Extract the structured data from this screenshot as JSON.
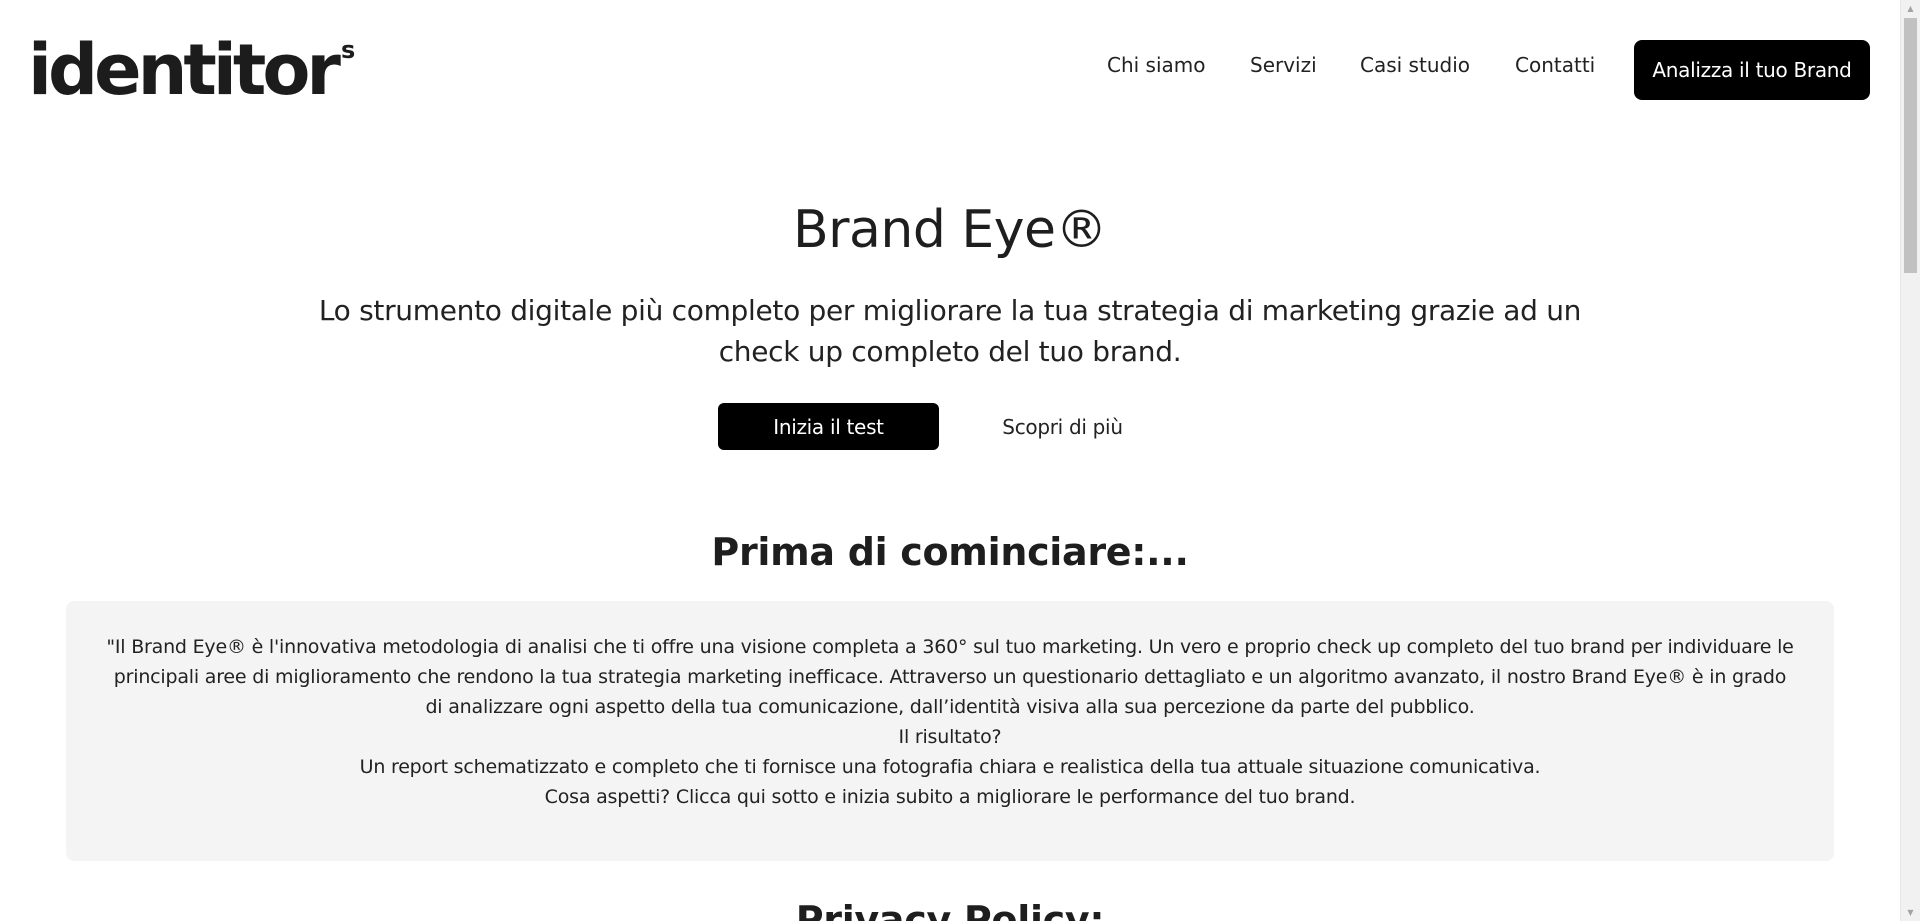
{
  "header": {
    "logo_text": "identitor",
    "logo_superscript": "s",
    "nav": [
      {
        "label": "Chi siamo"
      },
      {
        "label": "Servizi"
      },
      {
        "label": "Casi studio"
      },
      {
        "label": "Contatti"
      }
    ],
    "cta_label": "Analizza il tuo Brand"
  },
  "hero": {
    "title": "Brand Eye®",
    "subtitle": "Lo strumento digitale più completo per migliorare la tua strategia di marketing grazie ad un check up completo del tuo brand.",
    "primary_button": "Inizia il test",
    "secondary_button": "Scopri di più"
  },
  "intro": {
    "title": "Prima di cominciare:...",
    "paragraphs": [
      "\"Il Brand Eye® è l'innovativa metodologia di analisi che ti offre una visione completa a 360° sul tuo marketing. Un vero e proprio check up completo del tuo brand per individuare le principali aree di miglioramento che rendono la tua strategia marketing inefficace. Attraverso un questionario dettagliato e un algoritmo avanzato, il nostro Brand Eye® è in grado di analizzare ogni aspetto della tua comunicazione, dall’identità visiva alla sua percezione da parte del pubblico.",
      "Il risultato?",
      "Un report schematizzato e completo che ti fornisce una fotografia chiara e realistica della tua attuale situazione comunicativa.",
      "Cosa aspetti? Clicca qui sotto e inizia subito a migliorare le performance del tuo brand."
    ]
  },
  "privacy": {
    "title": "Privacy Policy:"
  },
  "colors": {
    "accent": "#000000",
    "intro_background": "#f4f4f4",
    "text": "#222222"
  }
}
